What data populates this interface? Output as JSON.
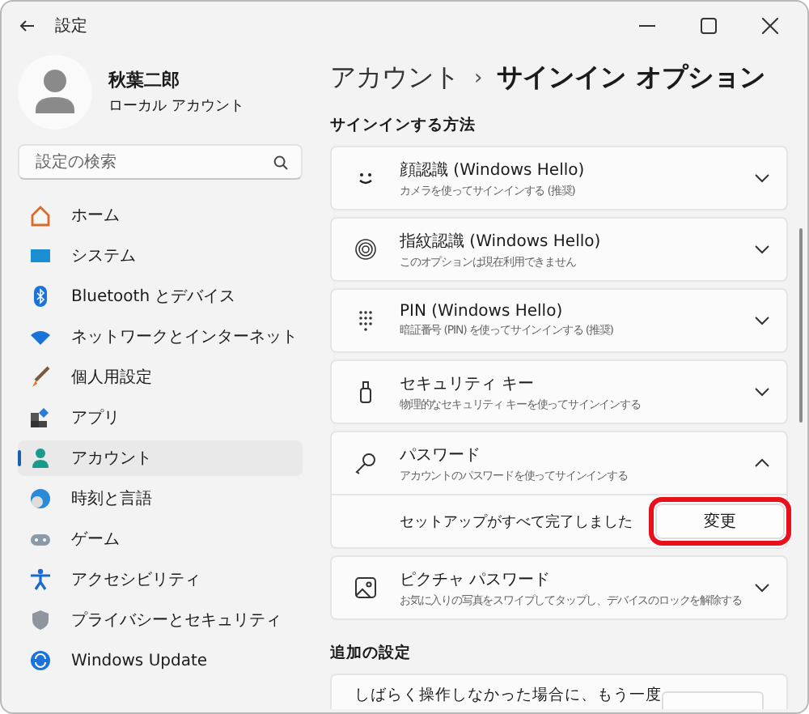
{
  "window": {
    "title": "設定"
  },
  "user": {
    "name": "秋葉二郎",
    "account_type": "ローカル アカウント"
  },
  "search": {
    "placeholder": "設定の検索"
  },
  "nav": [
    {
      "label": "ホーム",
      "selected": false
    },
    {
      "label": "システム",
      "selected": false
    },
    {
      "label": "Bluetooth とデバイス",
      "selected": false
    },
    {
      "label": "ネットワークとインターネット",
      "selected": false
    },
    {
      "label": "個人用設定",
      "selected": false
    },
    {
      "label": "アプリ",
      "selected": false
    },
    {
      "label": "アカウント",
      "selected": true
    },
    {
      "label": "時刻と言語",
      "selected": false
    },
    {
      "label": "ゲーム",
      "selected": false
    },
    {
      "label": "アクセシビリティ",
      "selected": false
    },
    {
      "label": "プライバシーとセキュリティ",
      "selected": false
    },
    {
      "label": "Windows Update",
      "selected": false
    }
  ],
  "breadcrumb": {
    "parent": "アカウント",
    "separator": "›",
    "current": "サインイン オプション"
  },
  "section": {
    "heading": "サインインする方法",
    "items": [
      {
        "title": "顔認識 (Windows Hello)",
        "subtitle": "カメラを使ってサインインする (推奨)",
        "expanded": false
      },
      {
        "title": "指紋認識 (Windows Hello)",
        "subtitle": "このオプションは現在利用できません",
        "expanded": false
      },
      {
        "title": "PIN (Windows Hello)",
        "subtitle": "暗証番号 (PIN) を使ってサインインする (推奨)",
        "expanded": false
      },
      {
        "title": "セキュリティ キー",
        "subtitle": "物理的なセキュリティ キーを使ってサインインする",
        "expanded": false
      },
      {
        "title": "パスワード",
        "subtitle": "アカウントのパスワードを使ってサインインする",
        "expanded": true,
        "detail": {
          "text": "セットアップがすべて完了しました",
          "button": "変更",
          "highlighted": true
        }
      },
      {
        "title": "ピクチャ パスワード",
        "subtitle": "お気に入りの写真をスワイプしてタップし、デバイスのロックを解除する",
        "expanded": false
      }
    ]
  },
  "additional": {
    "heading": "追加の設定",
    "text": "しばらく操作しなかった場合に、もう一度"
  }
}
